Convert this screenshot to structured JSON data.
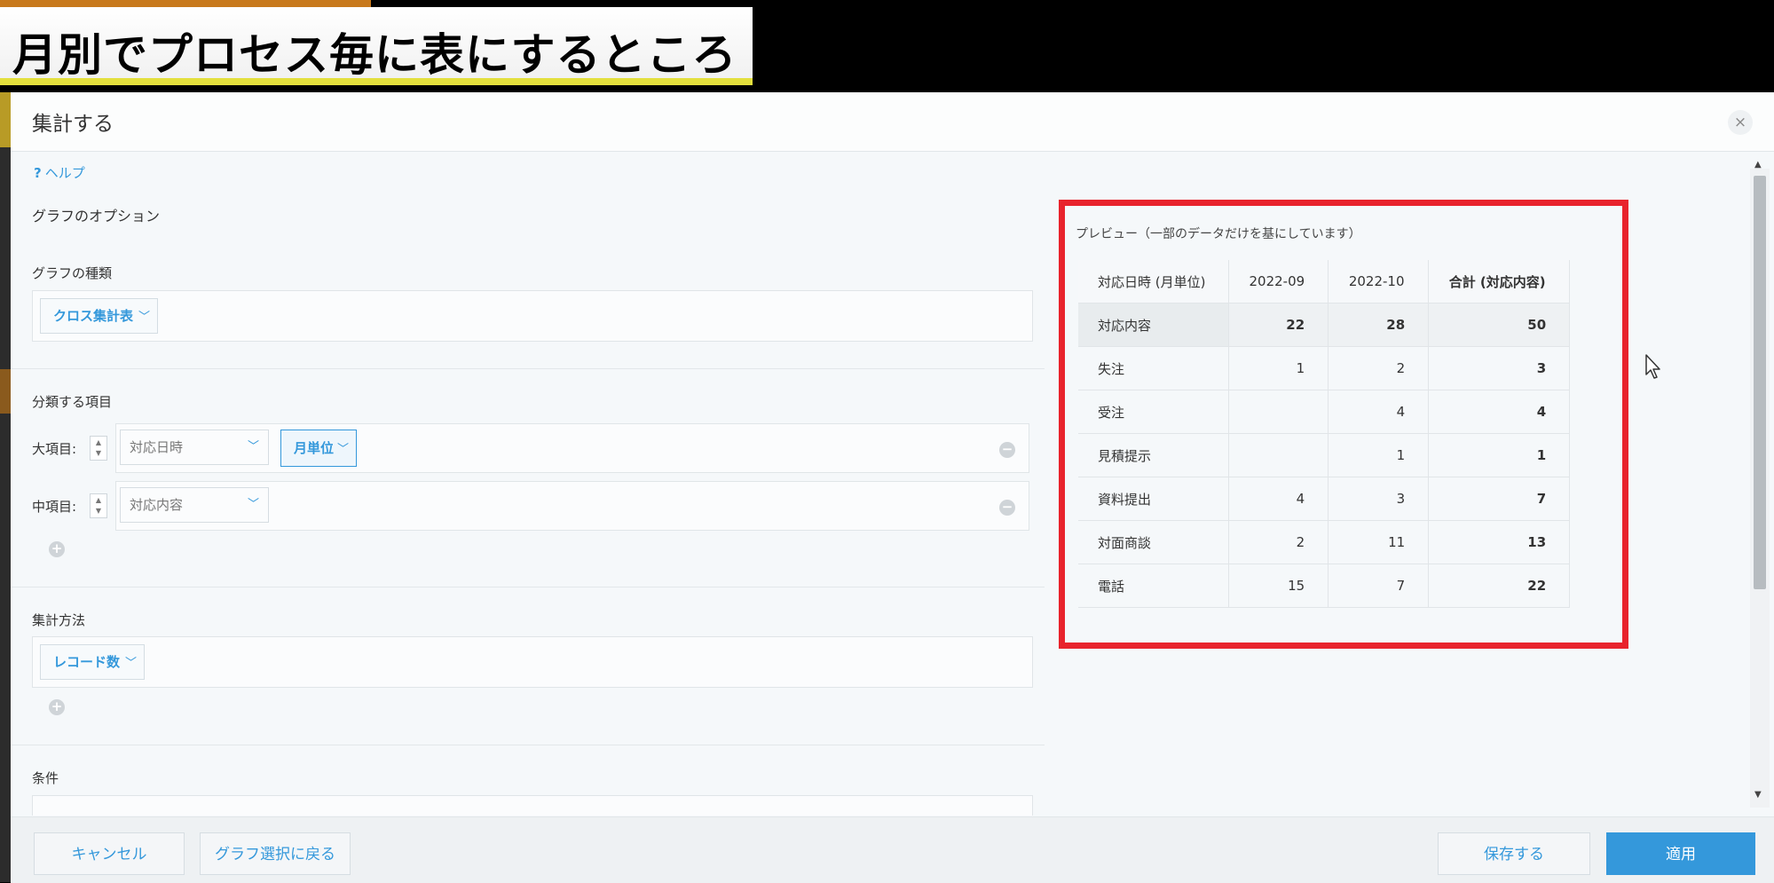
{
  "banner": {
    "text": "月別でプロセス毎に表にするところ"
  },
  "dialog": {
    "title": "集計する",
    "close_label": "×",
    "help": {
      "icon": "?",
      "label": "ヘルプ"
    }
  },
  "options": {
    "section_title": "グラフのオプション",
    "graph_type": {
      "label": "グラフの種類",
      "value": "クロス集計表"
    },
    "classify": {
      "label": "分類する項目",
      "major": {
        "label": "大項目:",
        "field": "対応日時",
        "unit": "月単位"
      },
      "middle": {
        "label": "中項目:",
        "field": "対応内容"
      }
    },
    "method": {
      "label": "集計方法",
      "value": "レコード数"
    },
    "condition": {
      "label": "条件"
    }
  },
  "preview": {
    "title": "プレビュー（一部のデータだけを基にしています）",
    "columns": [
      "対応日時 (月単位)",
      "2022-09",
      "2022-10",
      "合計 (対応内容)"
    ],
    "rows": [
      {
        "label": "対応内容",
        "v1": "22",
        "v2": "28",
        "total": "50"
      },
      {
        "label": "失注",
        "v1": "1",
        "v2": "2",
        "total": "3"
      },
      {
        "label": "受注",
        "v1": "",
        "v2": "4",
        "total": "4"
      },
      {
        "label": "見積提示",
        "v1": "",
        "v2": "1",
        "total": "1"
      },
      {
        "label": "資料提出",
        "v1": "4",
        "v2": "3",
        "total": "7"
      },
      {
        "label": "対面商談",
        "v1": "2",
        "v2": "11",
        "total": "13"
      },
      {
        "label": "電話",
        "v1": "15",
        "v2": "7",
        "total": "22"
      }
    ]
  },
  "footer": {
    "cancel": "キャンセル",
    "back": "グラフ選択に戻る",
    "save": "保存する",
    "apply": "適用"
  },
  "icons": {
    "chevron": "chevron-down-icon",
    "add": "plus-circle-icon",
    "remove": "minus-circle-icon",
    "stepper": "sort-stepper-icon",
    "cursor": "mouse-cursor-icon"
  },
  "colors": {
    "accent": "#3498db",
    "highlight_frame": "#e8232c",
    "banner_underline": "#e3df3d"
  }
}
